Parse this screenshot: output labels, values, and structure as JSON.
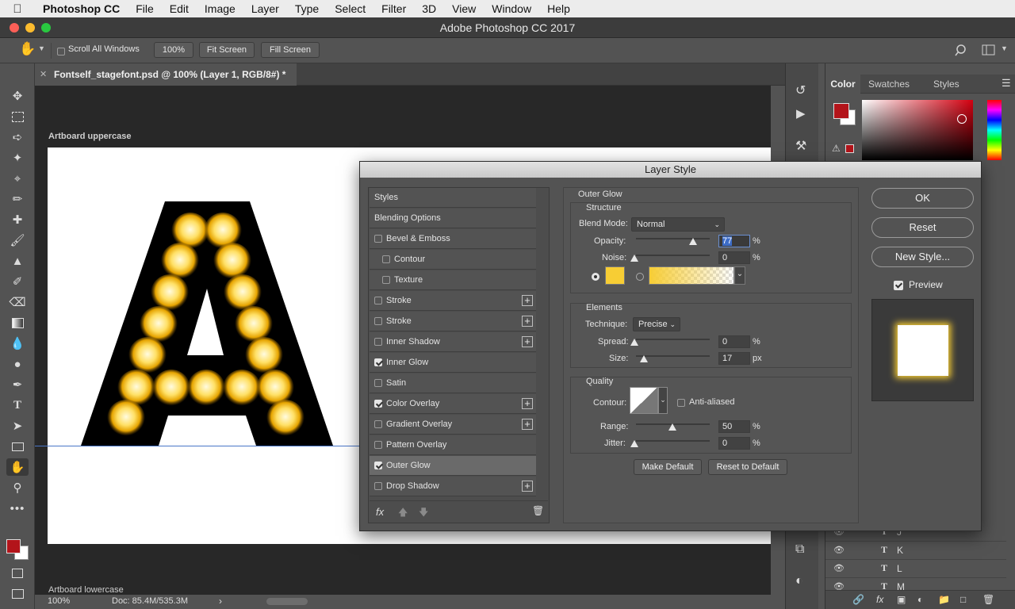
{
  "menubar": {
    "apple": "",
    "items": [
      "Photoshop CC",
      "File",
      "Edit",
      "Image",
      "Layer",
      "Type",
      "Select",
      "Filter",
      "3D",
      "View",
      "Window",
      "Help"
    ]
  },
  "window": {
    "title": "Adobe Photoshop CC 2017"
  },
  "options": {
    "scroll_all_windows": "Scroll All Windows",
    "zoom": "100%",
    "fit_screen": "Fit Screen",
    "fill_screen": "Fill Screen"
  },
  "document": {
    "tab_title": "Fontself_stagefont.psd @ 100% (Layer 1, RGB/8#) *",
    "artboard_upper": "Artboard uppercase",
    "artboard_lower": "Artboard lowercase",
    "letter": "A"
  },
  "status": {
    "zoom": "100%",
    "doc": "Doc: 85.4M/535.3M"
  },
  "color_panel": {
    "tabs": [
      "Color",
      "Swatches",
      "Styles"
    ],
    "foreground": "#b3141a",
    "background": "#ffffff"
  },
  "layers_visible": [
    {
      "name": "J"
    },
    {
      "name": "K"
    },
    {
      "name": "L"
    },
    {
      "name": "M"
    }
  ],
  "dialog": {
    "title": "Layer Style",
    "styles_header": "Styles",
    "blending_options": "Blending Options",
    "items": [
      {
        "label": "Bevel & Emboss",
        "checked": false,
        "plus": false,
        "indent": false
      },
      {
        "label": "Contour",
        "checked": false,
        "plus": false,
        "indent": true
      },
      {
        "label": "Texture",
        "checked": false,
        "plus": false,
        "indent": true
      },
      {
        "label": "Stroke",
        "checked": false,
        "plus": true,
        "indent": false
      },
      {
        "label": "Stroke",
        "checked": false,
        "plus": true,
        "indent": false
      },
      {
        "label": "Inner Shadow",
        "checked": false,
        "plus": true,
        "indent": false
      },
      {
        "label": "Inner Glow",
        "checked": true,
        "plus": false,
        "indent": false
      },
      {
        "label": "Satin",
        "checked": false,
        "plus": false,
        "indent": false
      },
      {
        "label": "Color Overlay",
        "checked": true,
        "plus": true,
        "indent": false
      },
      {
        "label": "Gradient Overlay",
        "checked": false,
        "plus": true,
        "indent": false
      },
      {
        "label": "Pattern Overlay",
        "checked": false,
        "plus": false,
        "indent": false
      },
      {
        "label": "Outer Glow",
        "checked": true,
        "plus": false,
        "indent": false,
        "selected": true
      },
      {
        "label": "Drop Shadow",
        "checked": false,
        "plus": true,
        "indent": false
      }
    ],
    "fx_label": "fx",
    "section_title": "Outer Glow",
    "structure": {
      "title": "Structure",
      "blend_mode_label": "Blend Mode:",
      "blend_mode": "Normal",
      "opacity_label": "Opacity:",
      "opacity": "77",
      "noise_label": "Noise:",
      "noise": "0",
      "unit_percent": "%",
      "glow_color": "#f7cd34",
      "opacity_level": 0.77,
      "noise_level": 0.0
    },
    "elements": {
      "title": "Elements",
      "technique_label": "Technique:",
      "technique": "Precise",
      "spread_label": "Spread:",
      "spread": "0",
      "size_label": "Size:",
      "size": "17",
      "unit_px": "px",
      "spread_level": 0.0,
      "size_level": 0.09
    },
    "quality": {
      "title": "Quality",
      "contour_label": "Contour:",
      "anti_aliased": "Anti-aliased",
      "range_label": "Range:",
      "range": "50",
      "jitter_label": "Jitter:",
      "jitter": "0",
      "range_level": 0.5,
      "jitter_level": 0.0
    },
    "make_default": "Make Default",
    "reset_to_default": "Reset to Default",
    "ok": "OK",
    "reset": "Reset",
    "new_style": "New Style...",
    "preview": "Preview"
  }
}
